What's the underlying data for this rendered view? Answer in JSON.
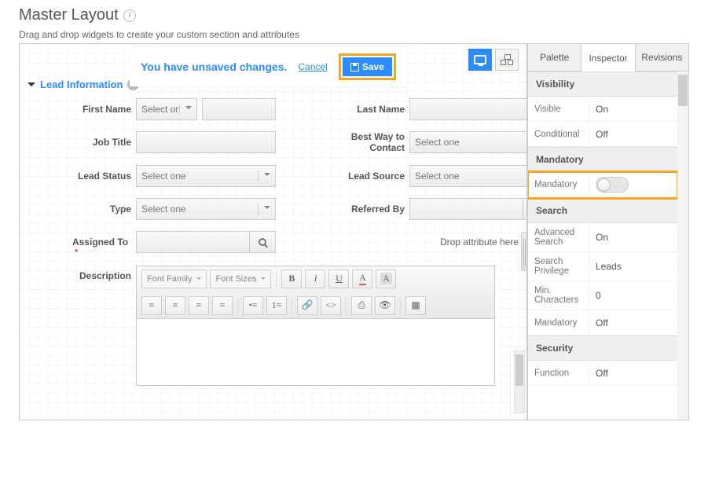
{
  "header": {
    "title": "Master Layout",
    "subtitle": "Drag and drop widgets to create your custom section and attributes"
  },
  "unsaved": {
    "message": "You have unsaved changes.",
    "cancel": "Cancel",
    "save": "Save"
  },
  "section": {
    "title": "Lead Information"
  },
  "labels": {
    "firstName": "First Name",
    "lastName": "Last Name",
    "jobTitle": "Job Title",
    "bestWay": "Best Way to Contact",
    "leadStatus": "Lead Status",
    "leadSource": "Lead Source",
    "type": "Type",
    "referredBy": "Referred By",
    "assignedTo": "Assigned To",
    "description": "Description"
  },
  "placeholders": {
    "selectOne": "Select one",
    "selectOr": "Select or",
    "dropHint": "Drop attribute here"
  },
  "rte": {
    "fontFamily": "Font Family",
    "fontSizes": "Font Sizes"
  },
  "tabs": {
    "palette": "Palette",
    "inspector": "Inspector",
    "revisions": "Revisions"
  },
  "inspector": {
    "visibilityH": "Visibility",
    "visible": {
      "k": "Visible",
      "v": "On"
    },
    "conditional": {
      "k": "Conditional",
      "v": "Off"
    },
    "mandatoryH": "Mandatory",
    "mandatory": {
      "k": "Mandatory"
    },
    "searchH": "Search",
    "advSearch": {
      "k": "Advanced Search",
      "v": "On"
    },
    "searchPriv": {
      "k": "Search Privilege",
      "v": "Leads"
    },
    "minChars": {
      "k": "Min. Characters",
      "v": "0"
    },
    "searchMandatory": {
      "k": "Mandatory",
      "v": "Off"
    },
    "securityH": "Security",
    "function": {
      "k": "Function",
      "v": "Off"
    }
  }
}
